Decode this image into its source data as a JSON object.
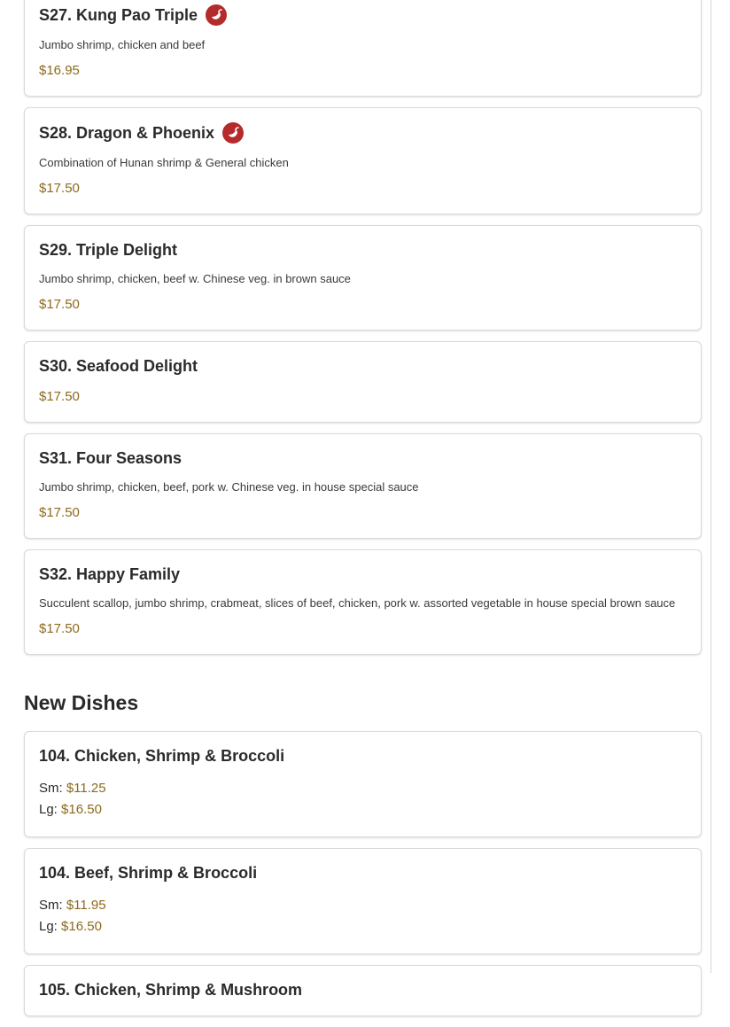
{
  "items": [
    {
      "name": "S27. Kung Pao Triple",
      "desc": "Jumbo shrimp, chicken and beef",
      "price": "$16.95"
    },
    {
      "name": "S28. Dragon & Phoenix",
      "desc": "Combination of Hunan shrimp & General chicken",
      "price": "$17.50"
    },
    {
      "name": "S29. Triple Delight",
      "desc": "Jumbo shrimp, chicken, beef w. Chinese veg. in brown sauce",
      "price": "$17.50"
    },
    {
      "name": "S30. Seafood Delight",
      "price": "$17.50"
    },
    {
      "name": "S31. Four Seasons",
      "desc": "Jumbo shrimp, chicken, beef, pork w. Chinese veg. in house special sauce",
      "price": "$17.50"
    },
    {
      "name": "S32. Happy Family",
      "desc": "Succulent scallop, jumbo shrimp, crabmeat, slices of beef, chicken, pork w. assorted vegetable in house special brown sauce",
      "price": "$17.50"
    }
  ],
  "new_dishes": {
    "heading": "New Dishes",
    "items": [
      {
        "name": "104. Chicken, Shrimp & Broccoli",
        "sm_label": "Sm:",
        "sm_price": "$11.25",
        "lg_label": "Lg:",
        "lg_price": "$16.50"
      },
      {
        "name": "104. Beef, Shrimp & Broccoli",
        "sm_label": "Sm:",
        "sm_price": "$11.95",
        "lg_label": "Lg:",
        "lg_price": "$16.50"
      },
      {
        "name": "105. Chicken, Shrimp & Mushroom"
      }
    ]
  },
  "icons": {
    "spicy": "hot-pepper-icon"
  },
  "colors": {
    "price": "#8c6a1c",
    "spicy": "#b52a2a"
  }
}
